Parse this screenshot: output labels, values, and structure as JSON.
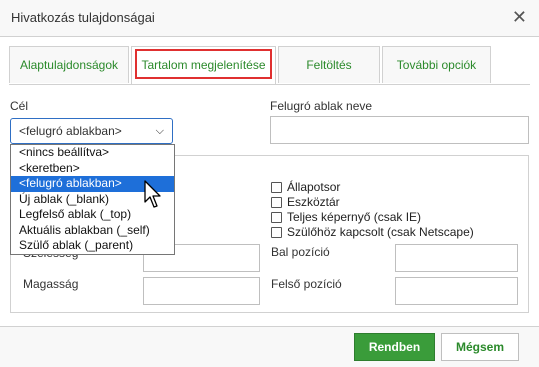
{
  "dialog": {
    "title": "Hivatkozás tulajdonságai",
    "close_glyph": "✕"
  },
  "tabs": [
    {
      "label": "Alaptulajdonságok"
    },
    {
      "label": "Tartalom megjelenítése"
    },
    {
      "label": "Feltöltés"
    },
    {
      "label": "További opciók"
    }
  ],
  "target": {
    "label": "Cél",
    "selected": "<felugró ablakban>",
    "options": [
      "<nincs beállítva>",
      "<keretben>",
      "<felugró ablakban>",
      "Új ablak (_blank)",
      "Legfelső ablak (_top)",
      "Aktuális ablakban (_self)",
      "Szülő ablak (_parent)"
    ],
    "selected_index": 2
  },
  "popup_name": {
    "label": "Felugró ablak neve",
    "value": ""
  },
  "popup_features": {
    "checkboxes": [
      {
        "label": "Állapotsor",
        "checked": false
      },
      {
        "label": "Eszköztár",
        "checked": false
      },
      {
        "label": "Teljes képernyő (csak IE)",
        "checked": false
      },
      {
        "label": "Szülőhöz kapcsolt (csak Netscape)",
        "checked": false
      }
    ],
    "width_label_partial": "Szélesség",
    "height_label": "Magasság",
    "left_label": "Bal pozíció",
    "top_label": "Felső pozíció"
  },
  "footer": {
    "ok_label": "Rendben",
    "cancel_label": "Mégsem"
  },
  "colors": {
    "accent_green": "#3a9c3a",
    "tab_text": "#2b8a2b",
    "highlight_red": "#e03030",
    "selection_blue": "#1e6fd9"
  }
}
